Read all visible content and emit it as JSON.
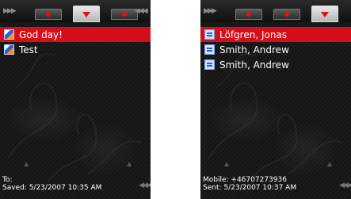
{
  "left_screen": {
    "tabs": [
      {
        "icon": "dot-icon"
      },
      {
        "icon": "triangle-down-icon",
        "active": true
      },
      {
        "icon": "dot-icon"
      }
    ],
    "list": [
      {
        "label": "God day!",
        "icon": "message-icon",
        "selected": true
      },
      {
        "label": "Test",
        "icon": "message-icon",
        "selected": false
      }
    ],
    "footer": {
      "line1": "To:",
      "line2": "Saved: 5/23/2007 10:35 AM"
    }
  },
  "right_screen": {
    "tabs": [
      {
        "icon": "dot-icon"
      },
      {
        "icon": "dot-icon"
      },
      {
        "icon": "triangle-down-icon",
        "active": true
      }
    ],
    "list": [
      {
        "label": "Löfgren, Jonas",
        "icon": "contact-icon",
        "selected": true
      },
      {
        "label": "Smith, Andrew",
        "icon": "contact-icon",
        "selected": false
      },
      {
        "label": "Smith, Andrew",
        "icon": "contact-icon",
        "selected": false
      }
    ],
    "footer": {
      "line1": "Mobile: +46707273936",
      "line2": "Sent: 5/23/2007 10:37 AM"
    }
  },
  "colors": {
    "selection": "#d40e1a",
    "accent_red": "#e0101c",
    "background": "#1a1a1a"
  }
}
